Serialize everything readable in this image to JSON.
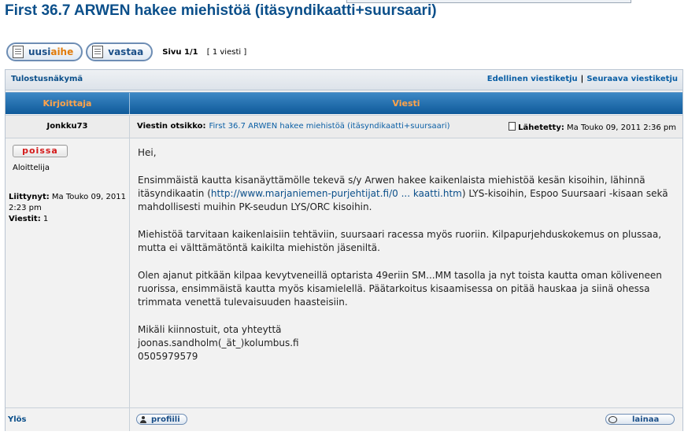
{
  "topic": {
    "title": "First 36.7 ARWEN hakee miehistöä (itäsyndikaatti+suursaari)"
  },
  "toolbar": {
    "new_topic_label_part1": "uusi",
    "new_topic_label_part2": "aihe",
    "reply_label": "vastaa",
    "page_label": "Sivu 1/1",
    "post_count": "[ 1 viesti ]"
  },
  "nav": {
    "print_view": "Tulostusnäkymä",
    "prev_topic": "Edellinen viestiketju",
    "separator": "|",
    "next_topic": "Seuraava viestiketju"
  },
  "columns": {
    "author": "Kirjoittaja",
    "message": "Viesti"
  },
  "post": {
    "author": "Jonkku73",
    "subject_label": "Viestin otsikko:",
    "subject": "First 36.7 ARWEN hakee miehistöä (itäsyndikaatti+suursaari)",
    "posted_label": "Lähetetty:",
    "posted_date": "Ma Touko 09, 2011 2:36 pm",
    "online_status": "poissa",
    "rank": "Aloittelija",
    "joined_label": "Liittynyt:",
    "joined_value": "Ma Touko 09, 2011 2:23 pm",
    "posts_label": "Viestit:",
    "posts_value": "1",
    "greeting": "Hei,",
    "para1_before": "Ensimmäistä kautta kisanäyttämölle tekevä s/y Arwen hakee kaikenlaista miehistöä kesän kisoihin, lähinnä itäsyndikaatin (",
    "para1_link": "http://www.marjaniemen-purjehtijat.fi/0 ... kaatti.htm",
    "para1_after": ") LYS-kisoihin, Espoo Suursaari -kisaan sekä mahdollisesti muihin PK-seudun LYS/ORC kisoihin.",
    "para2": "Miehistöä tarvitaan kaikenlaisiin tehtäviin, suursaari racessa myös ruoriin. Kilpapurjehduskokemus on plussaa, mutta ei välttämätöntä kaikilta miehistön jäseniltä.",
    "para3": "Olen ajanut pitkään kilpaa kevytveneillä optarista 49eriin SM...MM tasolla ja nyt toista kautta oman köliveneen ruorissa, ensimmäistä kautta myös kisamielellä. Päätarkoitus kisaamisessa on pitää hauskaa ja siinä ohessa trimmata venettä tulevaisuuden haasteisiin.",
    "contact1": "Mikäli kiinnostuit, ota yhteyttä",
    "contact2": "joonas.sandholm(_ät_)kolumbus.fi",
    "contact3": "0505979579"
  },
  "footer": {
    "up_label": "Ylös",
    "profile_label": "profiili",
    "quote_label": "lainaa"
  }
}
